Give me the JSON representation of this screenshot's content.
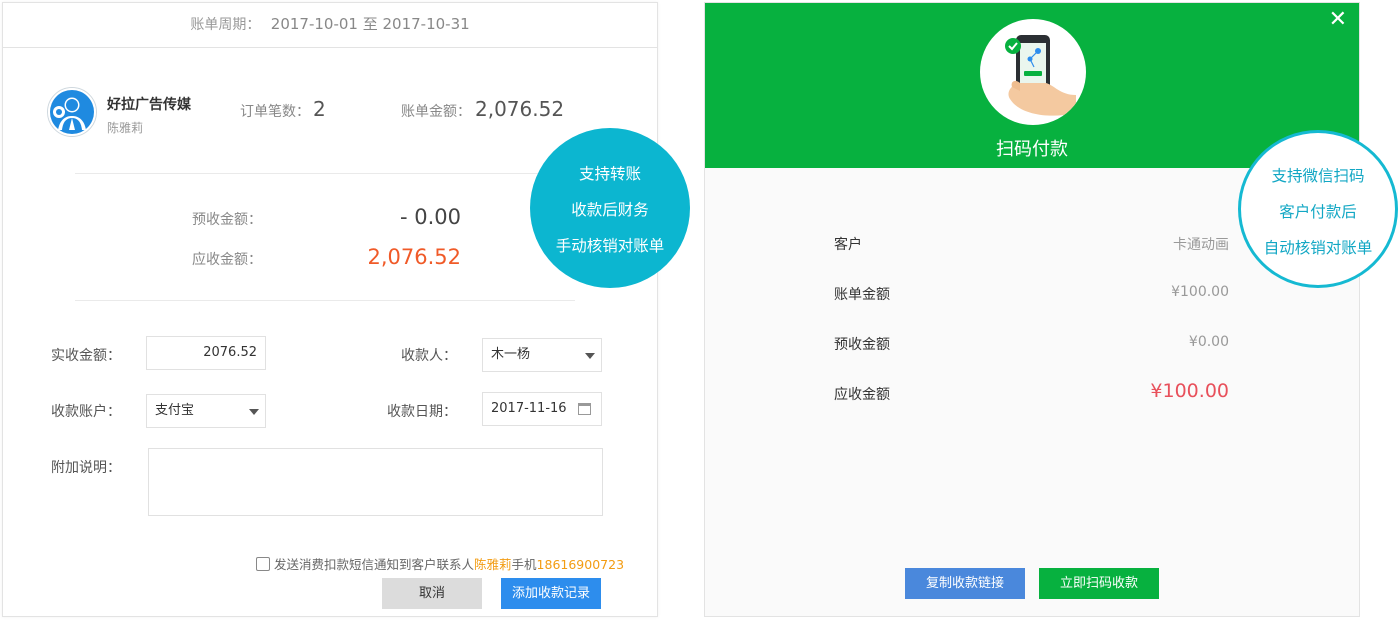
{
  "bill": {
    "period_label": "账单周期：",
    "period_value": "2017-10-01 至 2017-10-31",
    "customer": {
      "company": "好拉广告传媒",
      "contact": "陈雅莉",
      "avatar_icon": "user-avatar-icon"
    },
    "order_count_label": "订单笔数：",
    "order_count": "2",
    "bill_amount_label": "账单金额：",
    "bill_amount": "2,076.52",
    "prepaid_label": "预收金额：",
    "prepaid_value": "- 0.00",
    "receivable_label": "应收金额：",
    "receivable_value": "2,076.52"
  },
  "form": {
    "actual_amount_label": "实收金额：",
    "actual_amount_value": "2076.52",
    "payee_label": "收款人：",
    "payee_value": "木一杨",
    "account_label": "收款账户：",
    "account_value": "支付宝",
    "date_label": "收款日期：",
    "date_value": "2017-11-16",
    "note_label": "附加说明：",
    "note_value": "",
    "sms_text_before": "发送消费扣款短信通知到客户联系人",
    "sms_contact": "陈雅莉",
    "sms_text_mid": "手机",
    "sms_phone": "18616900723",
    "cancel_label": "取消",
    "submit_label": "添加收款记录"
  },
  "bubble_left": {
    "lines": [
      "支持转账",
      "收款后财务",
      "手动核销对账单"
    ]
  },
  "bubble_right": {
    "lines": [
      "支持微信扫码",
      "客户付款后",
      "自动核销对账单"
    ]
  },
  "scan_pay": {
    "close_icon": "close-icon",
    "title": "扫码付款",
    "rows": [
      {
        "label": "客户",
        "value": "卡通动画"
      },
      {
        "label": "账单金额",
        "value": "¥100.00"
      },
      {
        "label": "预收金额",
        "value": "¥0.00"
      },
      {
        "label": "应收金额",
        "value": "¥100.00"
      }
    ],
    "copy_link_label": "复制收款链接",
    "scan_now_label": "立即扫码收款"
  },
  "colors": {
    "accent_blue": "#2d8ded",
    "green": "#07b13f",
    "cyan_bubble": "#0cb6d0",
    "receivable_red": "#f05a28",
    "sms_orange": "#f39c12"
  }
}
